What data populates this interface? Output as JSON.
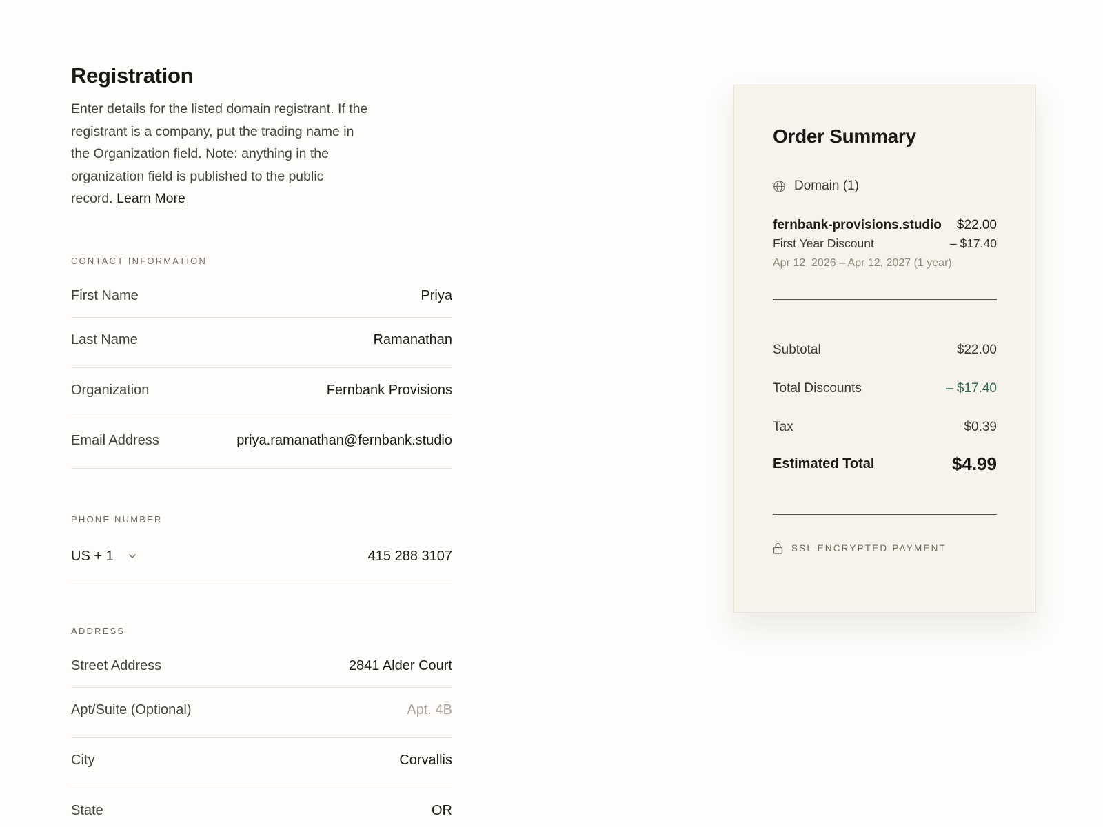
{
  "registration": {
    "title": "Registration",
    "intro_text": "Enter details for the listed domain registrant. If the registrant is a company, put the trading name in the Organization field. Note: anything in the organization field is published to the public record.",
    "learn_more_label": "Learn More"
  },
  "contact": {
    "section_label": "Contact Information",
    "fields": [
      {
        "label": "First Name",
        "value": "Priya"
      },
      {
        "label": "Last Name",
        "value": "Ramanathan"
      },
      {
        "label": "Organization",
        "value": "Fernbank Provisions"
      },
      {
        "label": "Email Address",
        "value": "priya.ramanathan@fernbank.studio"
      }
    ]
  },
  "phone": {
    "section_label": "Phone Number",
    "country_code": "US + 1",
    "number": "415 288 3107"
  },
  "address": {
    "section_label": "Address",
    "fields": [
      {
        "label": "Street Address",
        "value": "2841 Alder Court"
      },
      {
        "label": "Apt/Suite (Optional)",
        "placeholder": "Apt. 4B"
      },
      {
        "label": "City",
        "value": "Corvallis"
      },
      {
        "label": "State",
        "value": "OR"
      }
    ]
  },
  "summary": {
    "title": "Order Summary",
    "domain_header": "Domain (1)",
    "domain_icon": "globe-icon",
    "item": {
      "name": "fernbank-provisions.studio",
      "price": "$22.00",
      "discount_label": "First Year Discount",
      "discount_amount": "– $17.40",
      "period": "Apr 12, 2026 – Apr 12, 2027 (1 year)"
    },
    "subtotal_label": "Subtotal",
    "subtotal_value": "$22.00",
    "discounts_label": "Total Discounts",
    "discounts_value": "– $17.40",
    "tax_label": "Tax",
    "tax_value": "$0.39",
    "total_label": "Estimated Total",
    "total_value": "$4.99",
    "secure_label": "SSL Encrypted Payment",
    "secure_icon": "lock-icon"
  },
  "colors": {
    "page_bg": "#fefdfb",
    "card_bg": "#f6f3eb",
    "discount_green": "#2f6b4f",
    "muted_text": "#6e6a5f"
  }
}
